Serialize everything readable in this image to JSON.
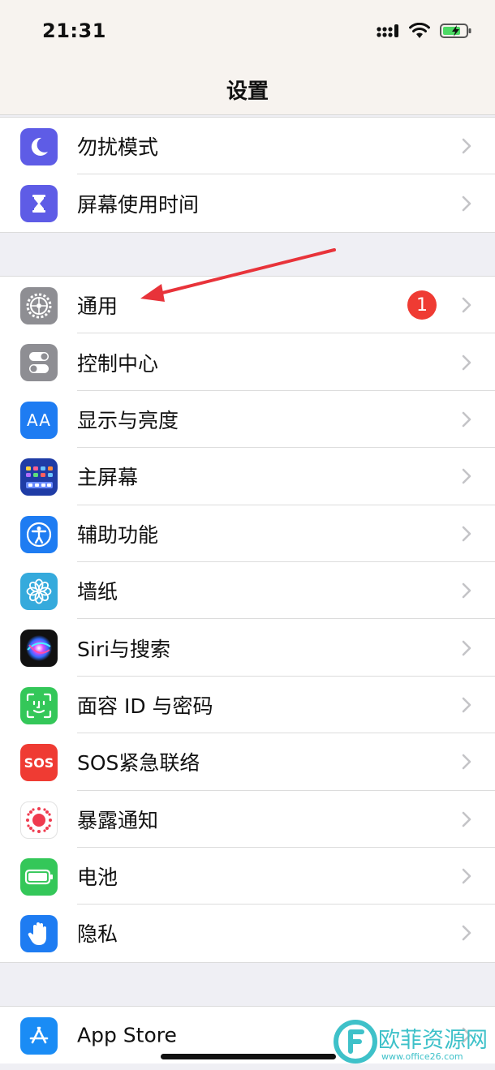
{
  "status_bar": {
    "time": "21:31"
  },
  "nav": {
    "title": "设置"
  },
  "group1": [
    {
      "label": "勿扰模式"
    },
    {
      "label": "屏幕使用时间"
    }
  ],
  "group2": [
    {
      "label": "通用",
      "badge": "1"
    },
    {
      "label": "控制中心"
    },
    {
      "label": "显示与亮度"
    },
    {
      "label": "主屏幕"
    },
    {
      "label": "辅助功能"
    },
    {
      "label": "墙纸"
    },
    {
      "label": "Siri与搜索"
    },
    {
      "label": "面容 ID 与密码"
    },
    {
      "label": "SOS紧急联络"
    },
    {
      "label": "暴露通知"
    },
    {
      "label": "电池"
    },
    {
      "label": "隐私"
    }
  ],
  "group3": [
    {
      "label": "App Store"
    }
  ],
  "icons": {
    "aa_text": "AA",
    "sos_text": "SOS"
  },
  "watermark": {
    "name": "欧菲资源网",
    "url": "www.office26.com"
  },
  "colors": {
    "badge": "#ef3b33",
    "arrow": "#e8333a"
  }
}
